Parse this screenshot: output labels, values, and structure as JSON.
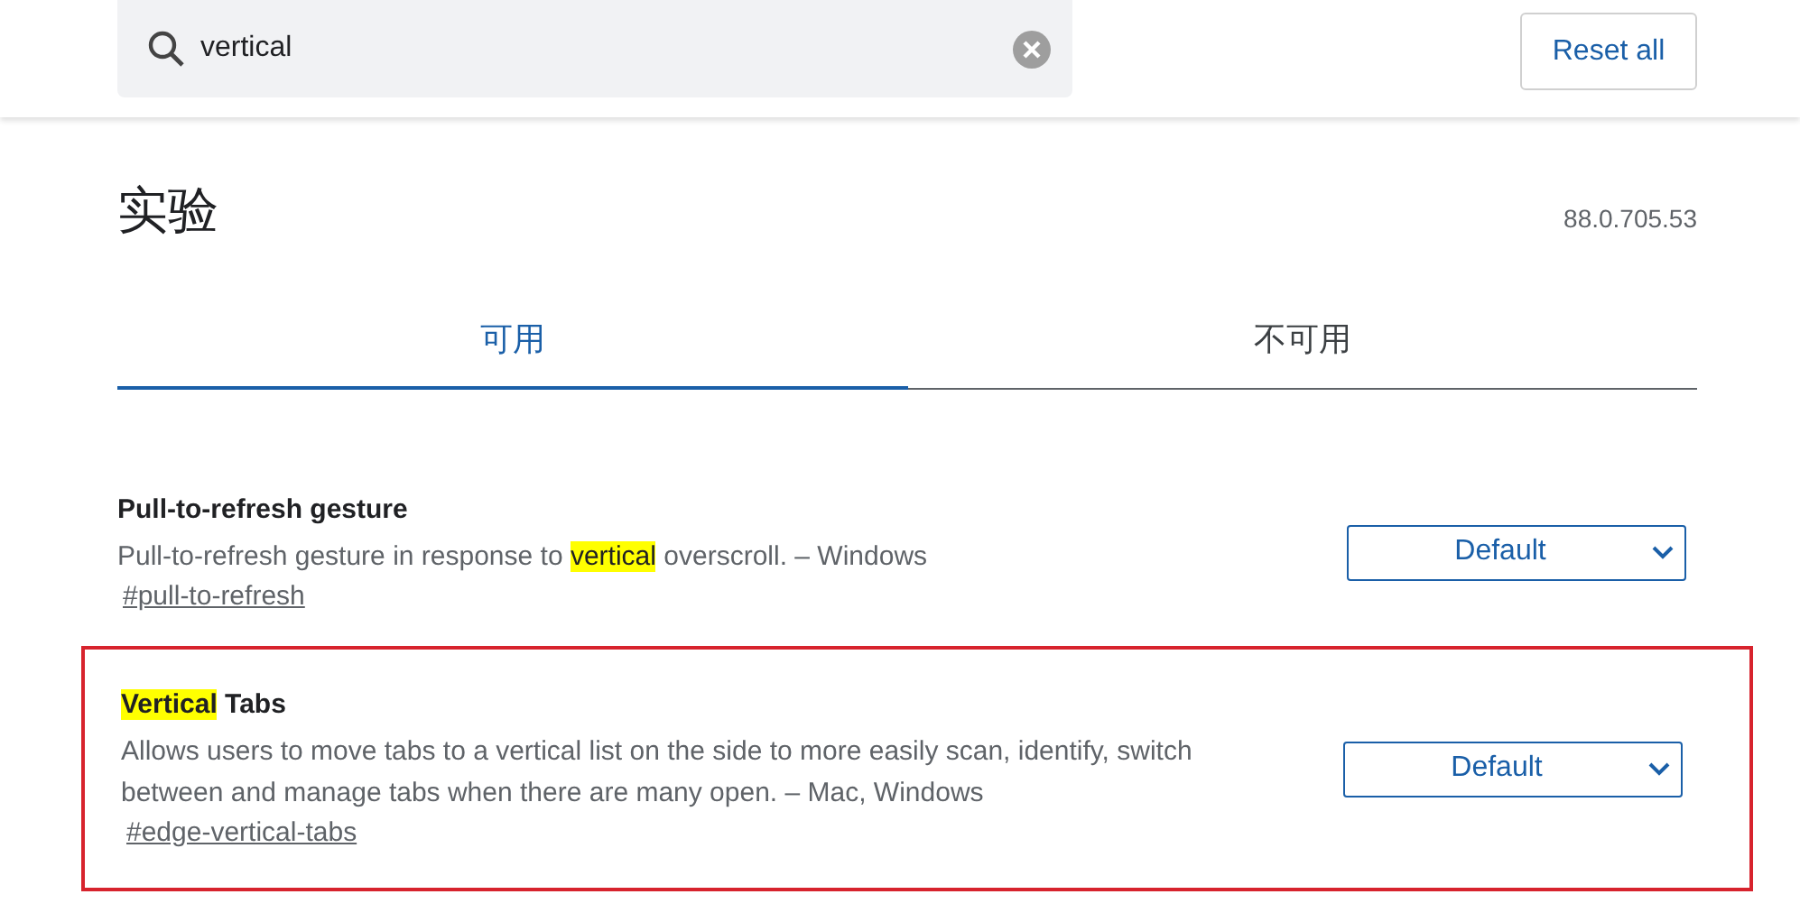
{
  "search": {
    "value": "vertical"
  },
  "reset_button": "Reset all",
  "page_title": "实验",
  "version": "88.0.705.53",
  "tabs": [
    {
      "label": "可用",
      "selected": true
    },
    {
      "label": "不可用",
      "selected": false
    }
  ],
  "experiments": [
    {
      "title": [
        {
          "text": "Pull-to-refresh gesture",
          "match": false
        }
      ],
      "description": [
        {
          "text": "Pull-to-refresh gesture in response to ",
          "match": false
        },
        {
          "text": "vertical",
          "match": true
        },
        {
          "text": " overscroll. – Windows",
          "match": false
        }
      ],
      "link": "#pull-to-refresh",
      "value": "Default",
      "outlined": false
    },
    {
      "title": [
        {
          "text": "Vertical",
          "match": true
        },
        {
          "text": " Tabs",
          "match": false
        }
      ],
      "description": [
        {
          "text": "Allows users to move tabs to a vertical list on the side to more easily scan, identify, switch between and manage tabs when there are many open. – Mac, Windows",
          "match": false
        }
      ],
      "link": "#edge-vertical-tabs",
      "value": "Default",
      "outlined": true
    }
  ]
}
